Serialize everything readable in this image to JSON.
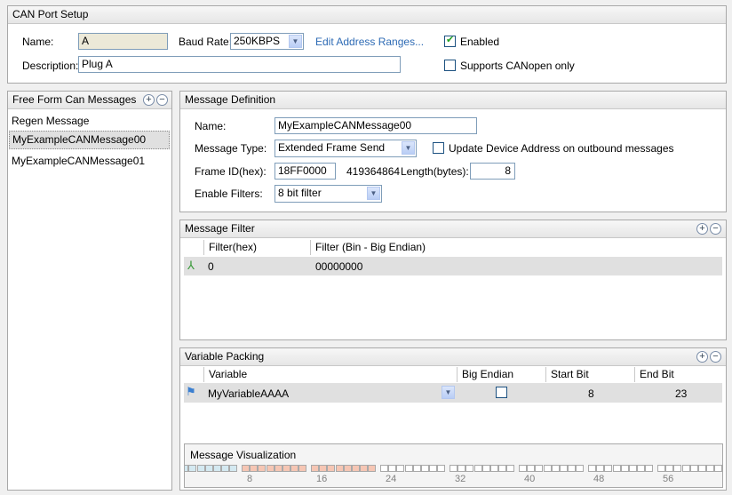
{
  "port_setup": {
    "title": "CAN Port Setup",
    "name_label": "Name:",
    "name_value": "A",
    "baud_label": "Baud Rate:",
    "baud_value": "250KBPS",
    "edit_link": "Edit Address Ranges...",
    "enabled_label": "Enabled",
    "enabled": true,
    "description_label": "Description:",
    "description_value": "Plug A",
    "canopen_label": "Supports CANopen only",
    "canopen": false
  },
  "messages": {
    "title": "Free Form Can Messages",
    "items": [
      {
        "label": "Regen Message"
      },
      {
        "label": "MyExampleCANMessage00",
        "selected": true
      },
      {
        "label": "MyExampleCANMessage01"
      }
    ]
  },
  "definition": {
    "title": "Message  Definition",
    "name_label": "Name:",
    "name_value": "MyExampleCANMessage00",
    "type_label": "Message Type:",
    "type_value": "Extended Frame Send",
    "update_label": "Update Device Address on outbound messages",
    "update_checked": false,
    "frame_label": "Frame ID(hex):",
    "frame_value": "18FF0000",
    "frame_decimal": "419364864",
    "length_label": "Length(bytes):",
    "length_value": "8",
    "filters_label": "Enable Filters:",
    "filters_value": "8 bit filter"
  },
  "filter": {
    "title": "Message Filter",
    "columns": [
      "Filter(hex)",
      "Filter (Bin - Big Endian)"
    ],
    "rows": [
      {
        "icon": "filter-node-icon",
        "hex": "0",
        "bin": "00000000"
      }
    ]
  },
  "packing": {
    "title": "Variable Packing",
    "columns": [
      "Variable",
      "Big Endian",
      "Start Bit",
      "End Bit"
    ],
    "rows": [
      {
        "icon": "variable-flag-icon",
        "variable": "MyVariableAAAA",
        "big_endian": false,
        "start_bit": "8",
        "end_bit": "23"
      }
    ],
    "visualization": {
      "title": "Message Visualization",
      "tick_labels": [
        "8",
        "16",
        "24",
        "32",
        "40",
        "48",
        "56"
      ],
      "highlight_bits": [
        8,
        23
      ],
      "colors": {
        "first_byte": "#d4e9f1",
        "variable": "#f6c6b4",
        "empty": "#ffffff"
      }
    }
  }
}
